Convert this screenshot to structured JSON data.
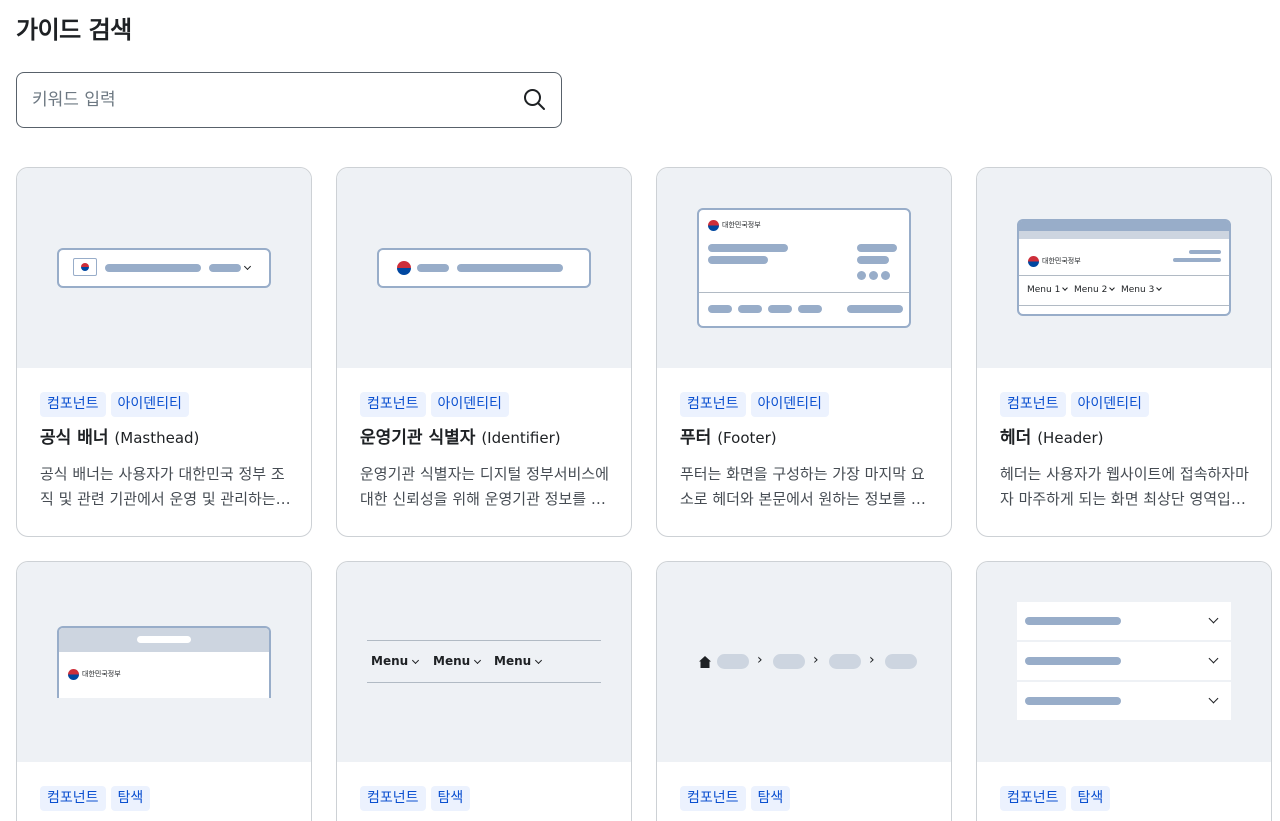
{
  "page": {
    "title": "가이드 검색"
  },
  "search": {
    "placeholder": "키워드 입력"
  },
  "illustration_text": {
    "agency": "대한민국정부",
    "menu1": "Menu 1",
    "menu2": "Menu 2",
    "menu3": "Menu 3",
    "menu": "Menu"
  },
  "cards": [
    {
      "tags": [
        "컴포넌트",
        "아이덴티티"
      ],
      "title": "공식 배너",
      "title_en": "(Masthead)",
      "desc": "공식 배너는 사용자가 대한민국 정부 조직 및 관련 기관에서 운영 및 관리하는 공식 웹사이트임을 알 수 있도록 합니다."
    },
    {
      "tags": [
        "컴포넌트",
        "아이덴티티"
      ],
      "title": "운영기관 식별자",
      "title_en": "(Identifier)",
      "desc": "운영기관 식별자는 디지털 정부서비스에 대한 신뢰성을 위해 운영기관 정보를 제공합니다."
    },
    {
      "tags": [
        "컴포넌트",
        "아이덴티티"
      ],
      "title": "푸터",
      "title_en": "(Footer)",
      "desc": "푸터는 화면을 구성하는 가장 마지막 요소로 헤더와 본문에서 원하는 정보를 찾지 못한 사용자에게 도움을 줍니다."
    },
    {
      "tags": [
        "컴포넌트",
        "아이덴티티"
      ],
      "title": "헤더",
      "title_en": "(Header)",
      "desc": "헤더는 사용자가 웹사이트에 접속하자마자 마주하게 되는 화면 최상단 영역입니다."
    },
    {
      "tags": [
        "컴포넌트",
        "탐색"
      ],
      "title": "",
      "title_en": "",
      "desc": ""
    },
    {
      "tags": [
        "컴포넌트",
        "탐색"
      ],
      "title": "",
      "title_en": "",
      "desc": ""
    },
    {
      "tags": [
        "컴포넌트",
        "탐색"
      ],
      "title": "",
      "title_en": "",
      "desc": ""
    },
    {
      "tags": [
        "컴포넌트",
        "탐색"
      ],
      "title": "",
      "title_en": "",
      "desc": ""
    }
  ],
  "icons": {
    "search": "search-icon",
    "home": "home-icon",
    "chevron": "chevron-down-icon",
    "flag": "korea-flag-icon",
    "emblem": "government-emblem-icon"
  },
  "colors": {
    "tag_bg": "#ecf2fe",
    "tag_text": "#0b50d0",
    "thumb_bg": "#eef1f5",
    "illustration": "#98adc9"
  }
}
